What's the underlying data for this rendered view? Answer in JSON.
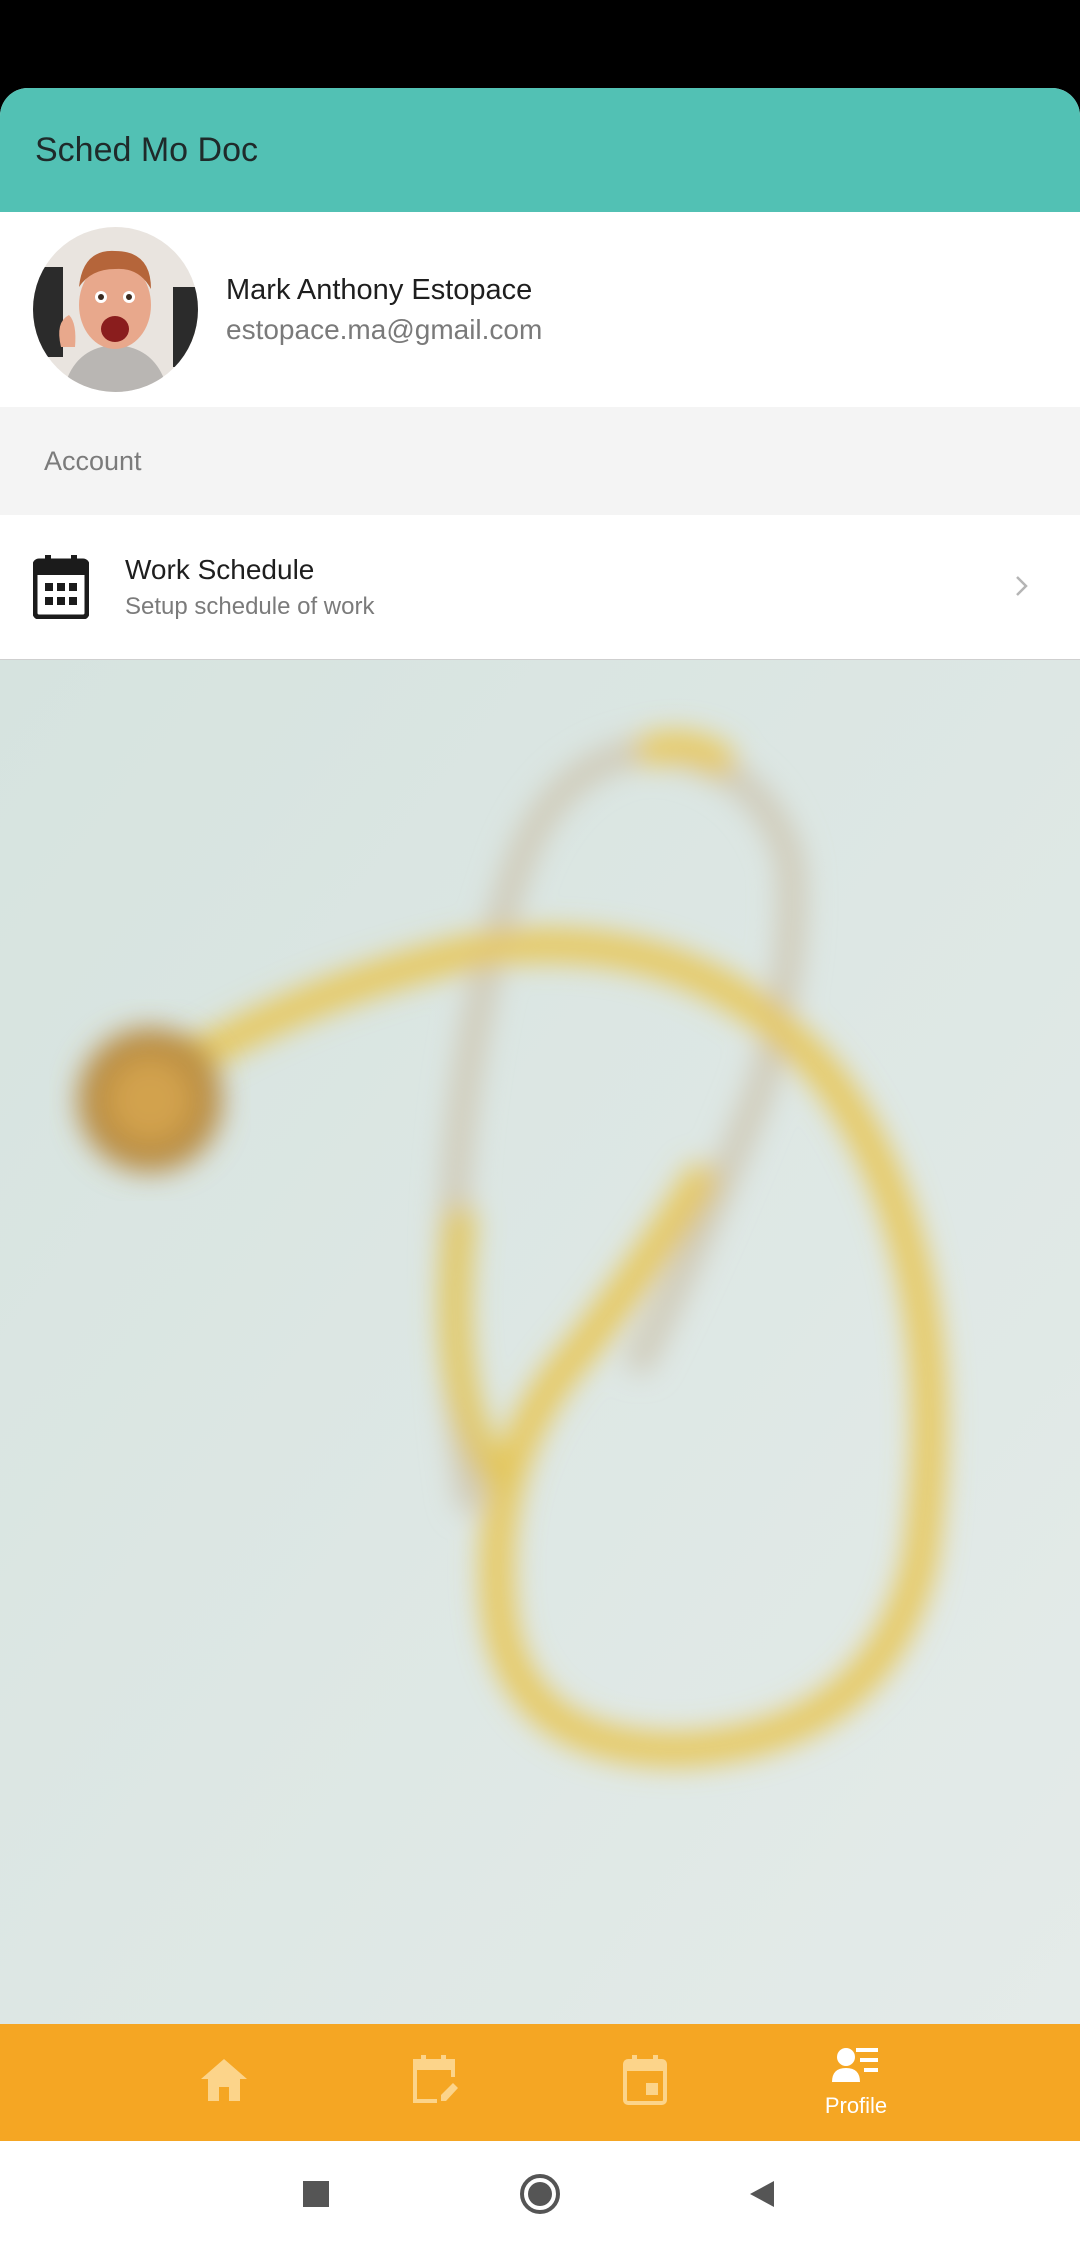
{
  "app": {
    "title": "Sched Mo Doc"
  },
  "profile": {
    "name": "Mark Anthony Estopace",
    "email": "estopace.ma@gmail.com"
  },
  "account_section": {
    "label": "Account",
    "items": [
      {
        "title": "Work Schedule",
        "subtitle": "Setup schedule of work",
        "icon": "calendar-grid-icon"
      }
    ]
  },
  "bottom_nav": {
    "items": [
      {
        "icon": "home-icon",
        "label": ""
      },
      {
        "icon": "calendar-edit-icon",
        "label": ""
      },
      {
        "icon": "calendar-event-icon",
        "label": ""
      },
      {
        "icon": "profile-list-icon",
        "label": "Profile"
      }
    ],
    "active_index": 3
  },
  "colors": {
    "app_bar": "#52c1b4",
    "bottom_nav": "#f5a623",
    "inactive_nav_icon": "#fcd48a",
    "active_nav_icon": "#ffffff"
  },
  "system_nav": [
    "recents-square-icon",
    "home-circle-icon",
    "back-triangle-icon"
  ]
}
